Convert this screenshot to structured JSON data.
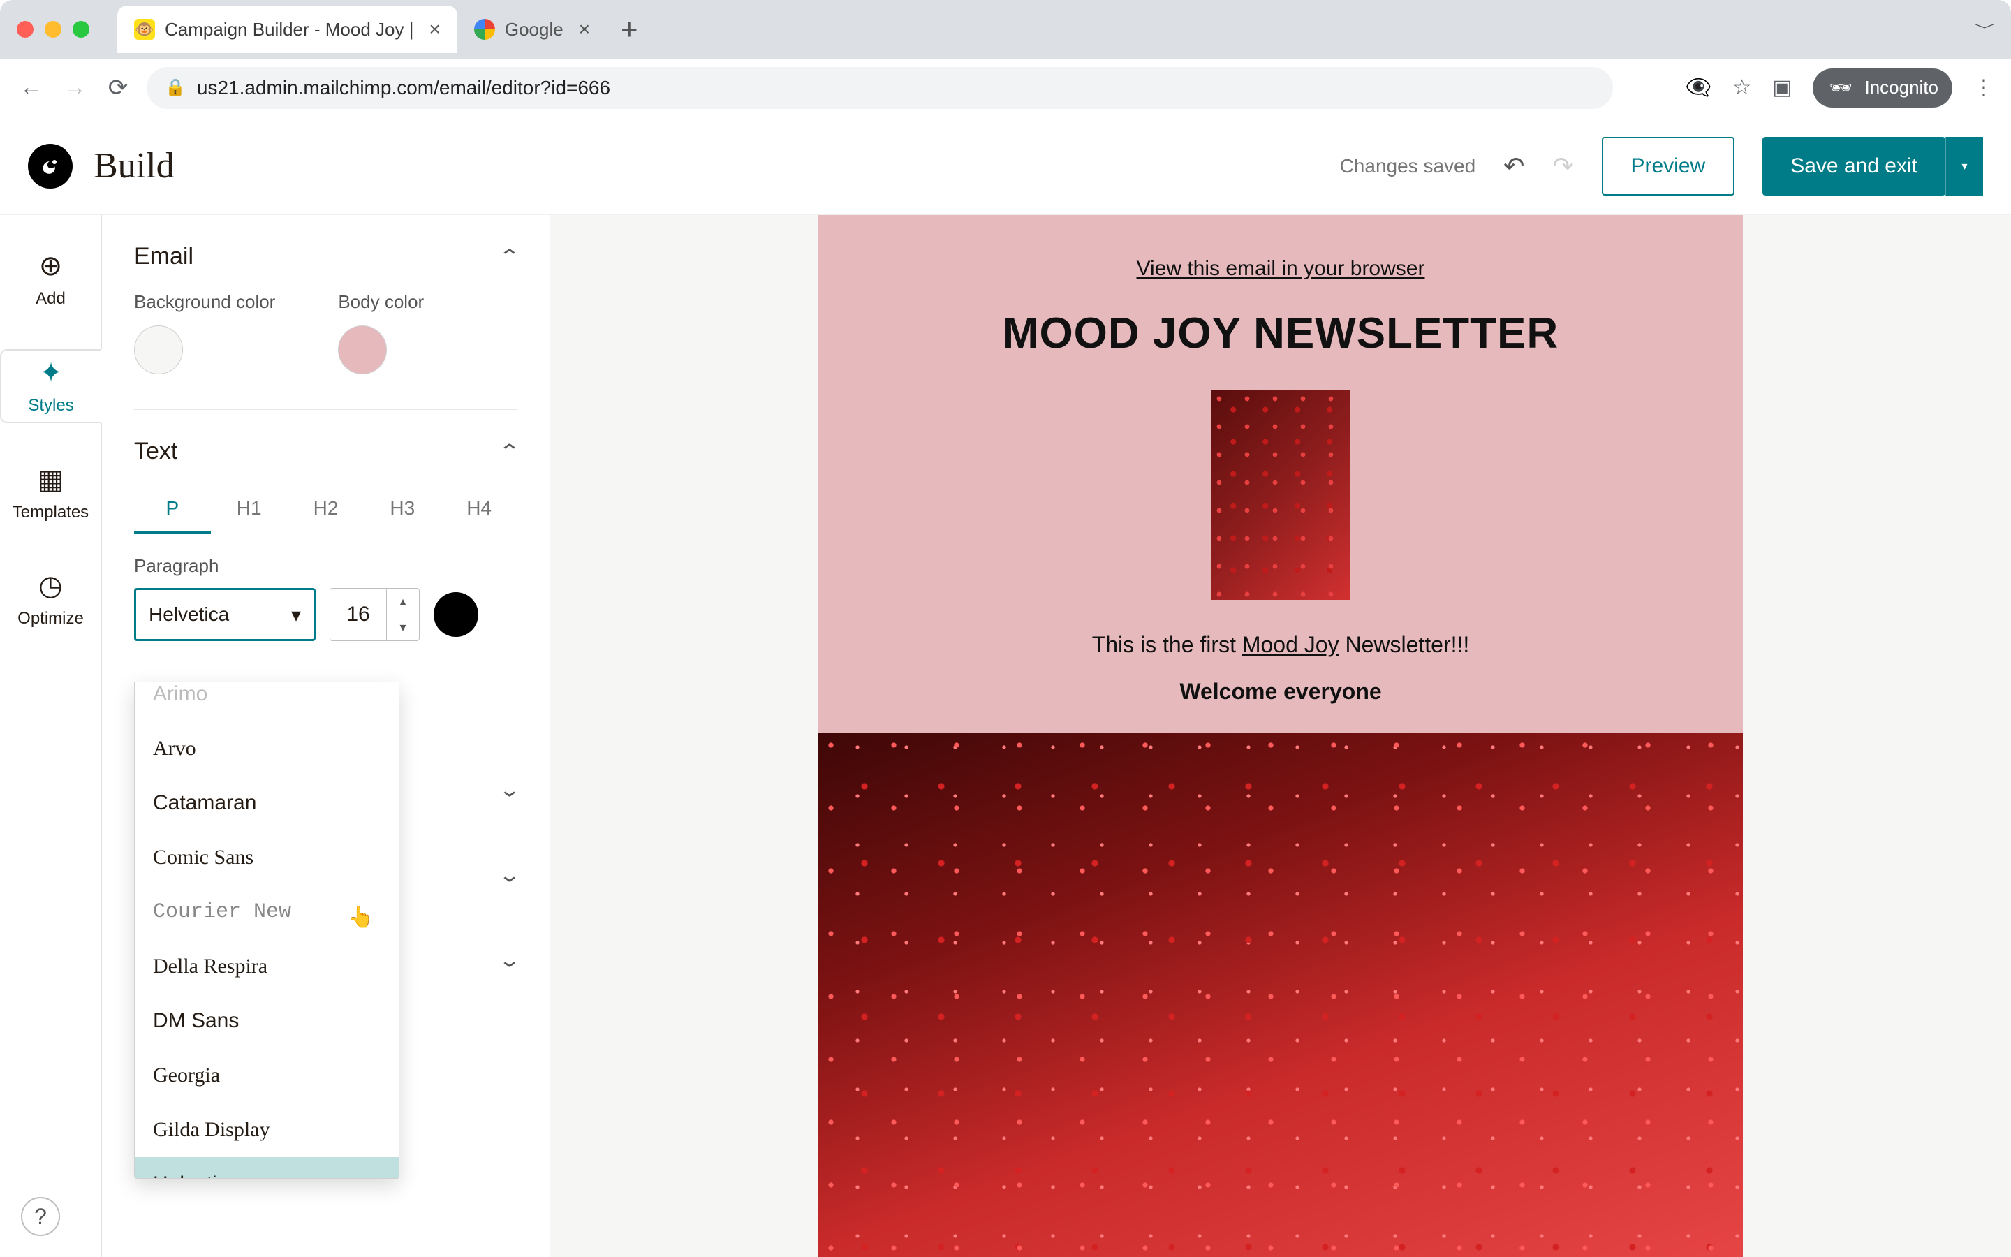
{
  "chrome": {
    "tabs": [
      {
        "label": "Campaign Builder - Mood Joy |",
        "active": true
      },
      {
        "label": "Google",
        "active": false
      }
    ],
    "url": "us21.admin.mailchimp.com/email/editor?id=666",
    "incognito_label": "Incognito"
  },
  "header": {
    "title": "Build",
    "status": "Changes saved",
    "preview": "Preview",
    "save": "Save and exit"
  },
  "rail": {
    "add": "Add",
    "styles": "Styles",
    "templates": "Templates",
    "optimize": "Optimize",
    "help": "?"
  },
  "panel": {
    "email_section": "Email",
    "bg_label": "Background color",
    "body_label": "Body color",
    "bg_color": "#f6f6f4",
    "body_color": "#e6b9bd",
    "text_section": "Text",
    "tabs": {
      "p": "P",
      "h1": "H1",
      "h2": "H2",
      "h3": "H3",
      "h4": "H4"
    },
    "paragraph_label": "Paragraph",
    "font_value": "Helvetica",
    "size_value": "16",
    "text_color": "#000000",
    "font_options_cut": "Arimo",
    "font_options": [
      "Arvo",
      "Catamaran",
      "Comic Sans",
      "Courier New",
      "Della Respira",
      "DM Sans",
      "Georgia",
      "Gilda Display",
      "Helvetica"
    ],
    "selected_font": "Helvetica"
  },
  "email": {
    "view_in_browser": "View this email in your browser",
    "headline": "MOOD JOY NEWSLETTER",
    "line_pre": "This is the first ",
    "line_link": "Mood Joy",
    "line_post": " Newsletter!!!",
    "subhead": "Welcome everyone"
  }
}
